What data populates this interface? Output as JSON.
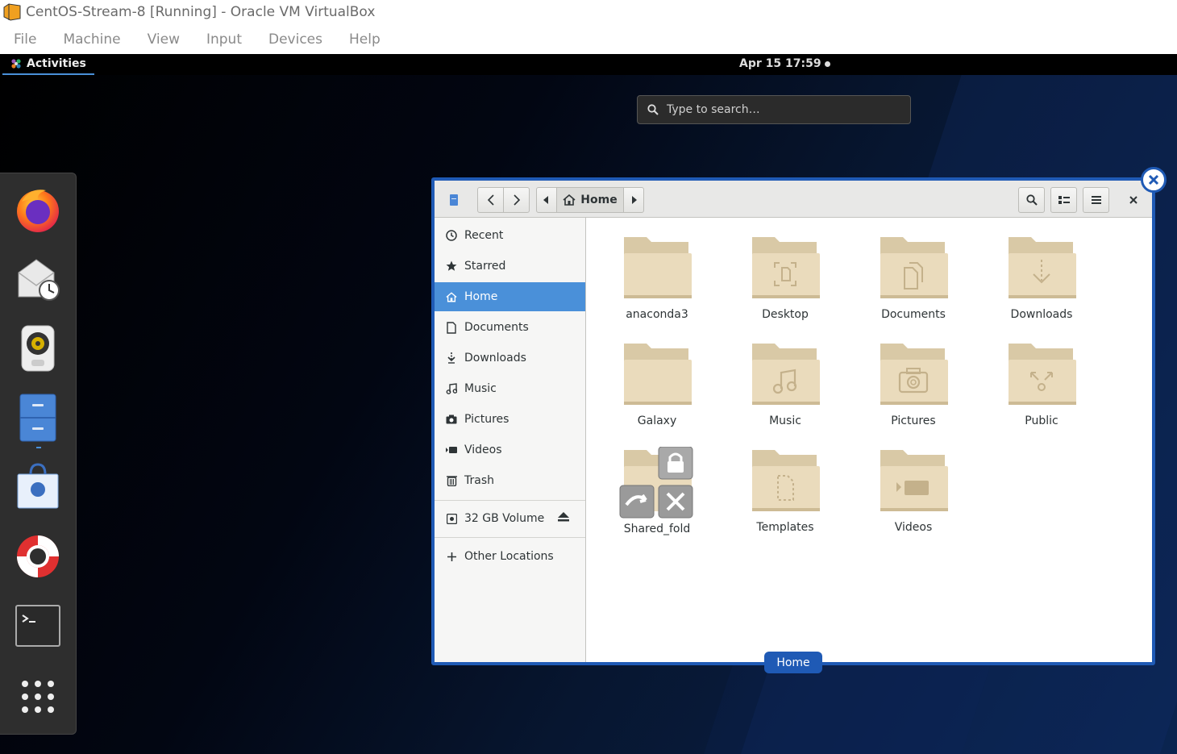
{
  "vbox": {
    "title": "CentOS-Stream-8 [Running] - Oracle VM VirtualBox",
    "menu": [
      "File",
      "Machine",
      "View",
      "Input",
      "Devices",
      "Help"
    ]
  },
  "gnome": {
    "activities_label": "Activities",
    "clock": "Apr 15  17:59",
    "search_placeholder": "Type to search…"
  },
  "dash": {
    "apps": [
      "firefox-icon",
      "evolution-mail-icon",
      "rhythmbox-icon",
      "files-icon",
      "software-icon",
      "help-icon",
      "terminal-icon",
      "show-applications-icon"
    ]
  },
  "files": {
    "path_label": "Home",
    "sidebar": [
      {
        "label": "Recent",
        "icon": "clock-icon"
      },
      {
        "label": "Starred",
        "icon": "star-icon"
      },
      {
        "label": "Home",
        "icon": "home-icon",
        "active": true
      },
      {
        "label": "Documents",
        "icon": "document-icon"
      },
      {
        "label": "Downloads",
        "icon": "download-icon"
      },
      {
        "label": "Music",
        "icon": "music-icon"
      },
      {
        "label": "Pictures",
        "icon": "camera-icon"
      },
      {
        "label": "Videos",
        "icon": "video-icon"
      },
      {
        "label": "Trash",
        "icon": "trash-icon"
      }
    ],
    "volume_label": "32 GB Volume",
    "other_locations": "Other Locations",
    "items": [
      {
        "name": "anaconda3",
        "emblem": "none"
      },
      {
        "name": "Desktop",
        "emblem": "desktop"
      },
      {
        "name": "Documents",
        "emblem": "documents"
      },
      {
        "name": "Downloads",
        "emblem": "downloads"
      },
      {
        "name": "Galaxy",
        "emblem": "none"
      },
      {
        "name": "Music",
        "emblem": "music"
      },
      {
        "name": "Pictures",
        "emblem": "pictures"
      },
      {
        "name": "Public",
        "emblem": "public"
      },
      {
        "name": "Shared_fold",
        "emblem": "shared"
      },
      {
        "name": "Templates",
        "emblem": "templates"
      },
      {
        "name": "Videos",
        "emblem": "videos"
      }
    ],
    "window_caption": "Home"
  },
  "colors": {
    "accent": "#4a90d9",
    "overview_border": "#1f5ab5",
    "folder": "#e8d7b7"
  }
}
